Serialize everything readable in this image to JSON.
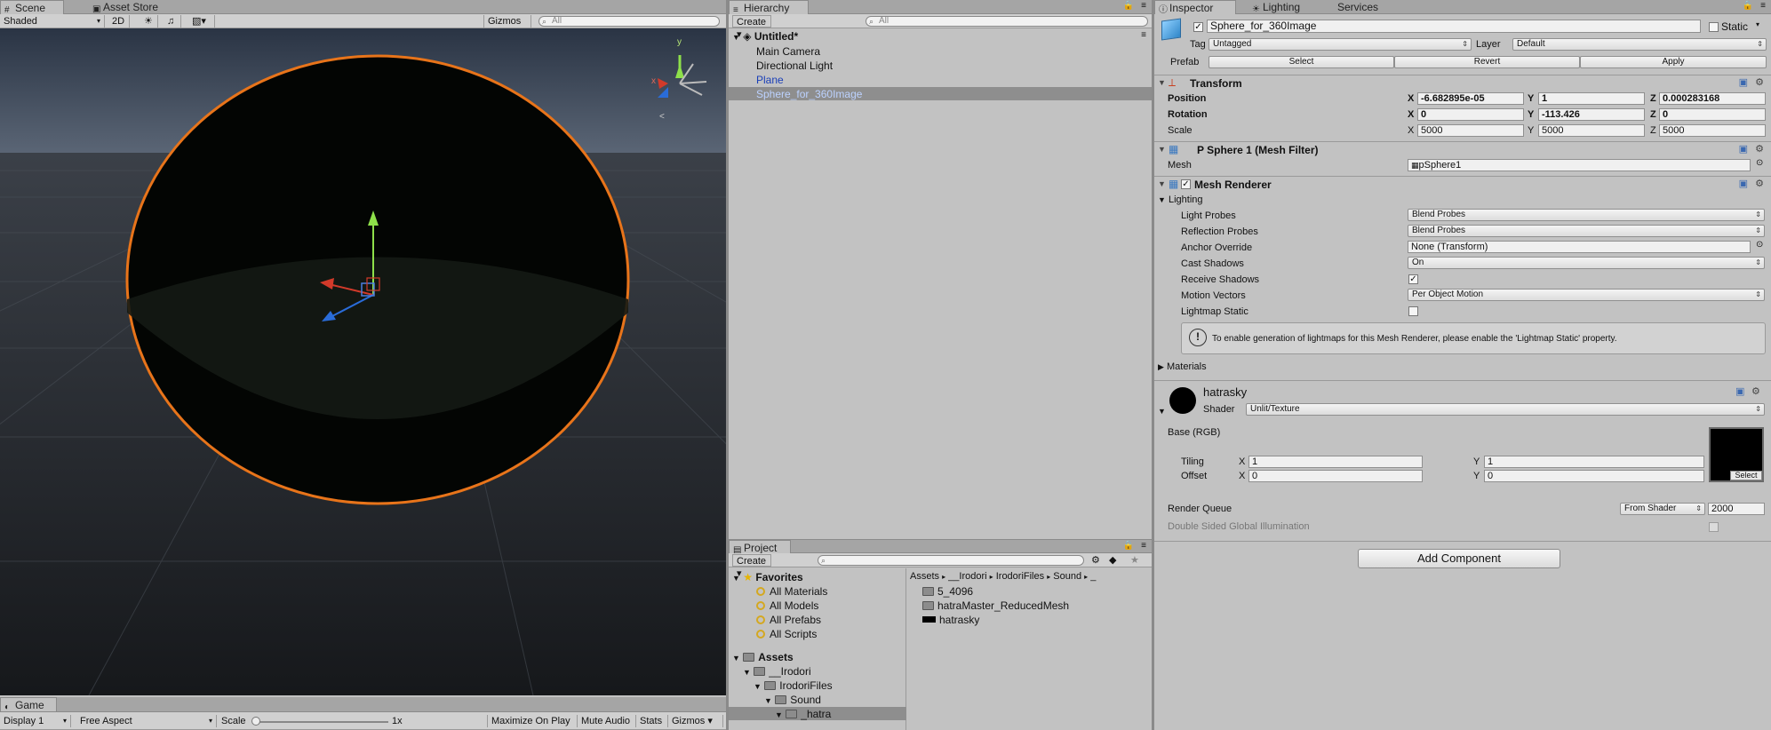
{
  "scene": {
    "tabs": [
      {
        "label": "Scene"
      },
      {
        "label": "Asset Store"
      }
    ],
    "toolbar": {
      "shading": "Shaded",
      "mode_2d": "2D",
      "gizmos": "Gizmos",
      "search_placeholder": "All"
    }
  },
  "game": {
    "tab": "Game",
    "display": "Display 1",
    "aspect": "Free Aspect",
    "scale_label": "Scale",
    "scale_value": "1x",
    "scale_fraction": 0.0,
    "maximize": "Maximize On Play",
    "mute": "Mute Audio",
    "stats": "Stats",
    "gizmos": "Gizmos"
  },
  "hierarchy": {
    "tab": "Hierarchy",
    "create": "Create",
    "search_placeholder": "All",
    "scene_name": "Untitled*",
    "items": [
      {
        "label": "Main Camera"
      },
      {
        "label": "Directional Light"
      },
      {
        "label": "Plane"
      },
      {
        "label": "Sphere_for_360Image"
      }
    ]
  },
  "project": {
    "tab": "Project",
    "create": "Create",
    "favorites": {
      "label": "Favorites",
      "items": [
        "All Materials",
        "All Models",
        "All Prefabs",
        "All Scripts"
      ]
    },
    "assets": {
      "label": "Assets",
      "tree": [
        "__Irodori",
        "IrodoriFiles",
        "Sound",
        "_hatra"
      ]
    },
    "breadcrumb": [
      "Assets",
      "__Irodori",
      "IrodoriFiles",
      "Sound",
      "_"
    ],
    "files": [
      "5_4096",
      "hatraMaster_ReducedMesh",
      "hatrasky"
    ]
  },
  "inspector": {
    "tabs": [
      {
        "label": "Inspector"
      },
      {
        "label": "Lighting"
      },
      {
        "label": "Services"
      }
    ],
    "object_name": "Sphere_for_360Image",
    "static_label": "Static",
    "tag_label": "Tag",
    "tag_value": "Untagged",
    "layer_label": "Layer",
    "layer_value": "Default",
    "prefab_label": "Prefab",
    "prefab_buttons": [
      "Select",
      "Revert",
      "Apply"
    ],
    "transform": {
      "title": "Transform",
      "position_label": "Position",
      "rotation_label": "Rotation",
      "scale_label": "Scale",
      "position": {
        "x": "-6.682895e-05",
        "y": "1",
        "z": "0.000283168"
      },
      "rotation": {
        "x": "0",
        "y": "-113.426",
        "z": "0"
      },
      "scale": {
        "x": "5000",
        "y": "5000",
        "z": "5000"
      }
    },
    "mesh_filter": {
      "title": "P Sphere 1 (Mesh Filter)",
      "mesh_label": "Mesh",
      "mesh_value": "pSphere1"
    },
    "mesh_renderer": {
      "title": "Mesh Renderer",
      "lighting_label": "Lighting",
      "light_probes_label": "Light Probes",
      "light_probes": "Blend Probes",
      "reflection_probes_label": "Reflection Probes",
      "reflection_probes": "Blend Probes",
      "anchor_override_label": "Anchor Override",
      "anchor_override": "None (Transform)",
      "cast_shadows_label": "Cast Shadows",
      "cast_shadows": "On",
      "receive_shadows_label": "Receive Shadows",
      "motion_vectors_label": "Motion Vectors",
      "motion_vectors": "Per Object Motion",
      "lightmap_static_label": "Lightmap Static",
      "info": "To enable generation of lightmaps for this Mesh Renderer, please enable the 'Lightmap Static' property.",
      "materials_label": "Materials"
    },
    "material": {
      "name": "hatrasky",
      "shader_label": "Shader",
      "shader": "Unlit/Texture",
      "base_label": "Base (RGB)",
      "tiling_label": "Tiling",
      "offset_label": "Offset",
      "tiling": {
        "x": "1",
        "y": "1"
      },
      "offset": {
        "x": "0",
        "y": "0"
      },
      "select_label": "Select",
      "render_queue_label": "Render Queue",
      "render_queue_mode": "From Shader",
      "render_queue_value": "2000",
      "double_sided_label": "Double Sided Global Illumination"
    },
    "add_component": "Add Component"
  },
  "colors": {
    "selection": "#8e8e8e",
    "accent_orange": "#e8741a",
    "link_blue": "#1a3fb8"
  }
}
